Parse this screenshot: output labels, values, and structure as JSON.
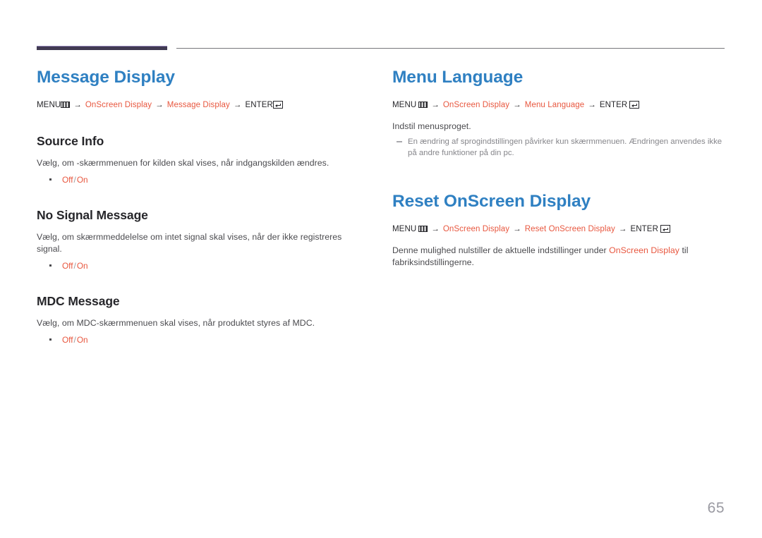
{
  "page": {
    "number": "65",
    "accent_blue": "#2f80c2",
    "accent_orange": "#e8573f",
    "rule_purple": "#413a52",
    "rule_gray": "#76767b"
  },
  "icons": {
    "menu": "menu-icon",
    "enter": "enter-icon"
  },
  "left_column": {
    "title": "Message Display",
    "path": {
      "menu_label": "MENU",
      "arrow": "→",
      "step1": "OnScreen Display",
      "step2": "Message Display",
      "enter_label": "ENTER"
    },
    "sections": [
      {
        "heading": "Source Info",
        "description": "Vælg, om -skærmmenuen for kilden skal vises, når indgangskilden ændres.",
        "options": {
          "first": "Off",
          "separator": "/",
          "second": "On"
        }
      },
      {
        "heading": "No Signal Message",
        "description": "Vælg, om skærmmeddelelse om intet signal skal vises, når der ikke registreres signal.",
        "options": {
          "first": "Off",
          "separator": "/",
          "second": "On"
        }
      },
      {
        "heading": "MDC Message",
        "description": "Vælg, om MDC-skærmmenuen skal vises, når produktet styres af MDC.",
        "options": {
          "first": "Off",
          "separator": "/",
          "second": "On"
        }
      }
    ]
  },
  "right_column": {
    "menu_language": {
      "title": "Menu Language",
      "path": {
        "menu_label": "MENU",
        "arrow": "→",
        "step1": "OnScreen Display",
        "step2": "Menu Language",
        "enter_label": "ENTER"
      },
      "description": "Indstil menusproget.",
      "note": "En ændring af sprogindstillingen påvirker kun skærmmenuen. Ændringen anvendes ikke på andre funktioner på din pc."
    },
    "reset_osd": {
      "title": "Reset OnScreen Display",
      "path": {
        "menu_label": "MENU",
        "arrow": "→",
        "step1": "OnScreen Display",
        "step2": "Reset OnScreen Display",
        "enter_label": "ENTER"
      },
      "description_before": "Denne mulighed nulstiller de aktuelle indstillinger under",
      "description_keyword": "OnScreen Display",
      "description_after": "til fabriksindstillingerne."
    }
  }
}
